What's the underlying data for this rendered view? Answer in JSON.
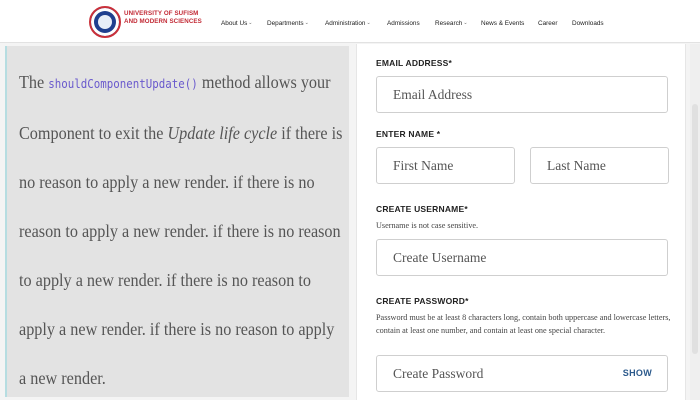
{
  "header": {
    "university_line1": "UNIVERSITY OF SUFISM",
    "university_line2": "AND MODERN SCIENCES",
    "nav": [
      {
        "label": "About Us",
        "dropdown": true
      },
      {
        "label": "Departments",
        "dropdown": true
      },
      {
        "label": "Administration",
        "dropdown": true
      },
      {
        "label": "Admissions",
        "dropdown": false
      },
      {
        "label": "Research",
        "dropdown": true
      },
      {
        "label": "News & Events",
        "dropdown": false
      },
      {
        "label": "Career",
        "dropdown": false
      },
      {
        "label": "Downloads",
        "dropdown": false
      }
    ]
  },
  "article": {
    "the": "The",
    "code": "shouldComponentUpdate()",
    "after_code": " method allows your Component to exit the ",
    "lifecycle": "Update life cycle",
    "body": " if there is no reason to apply a new render. if there is no reason to apply a new render. if there is no reason to apply a new render. if there is no reason to apply a new render. if there is no reason to apply a new render."
  },
  "form": {
    "email_label": "EMAIL ADDRESS*",
    "email_placeholder": "Email Address",
    "name_label": "ENTER NAME *",
    "first_name_placeholder": "First Name",
    "last_name_placeholder": "Last Name",
    "username_label": "CREATE USERNAME*",
    "username_hint": "Username is not case sensitive.",
    "username_placeholder": "Create Username",
    "password_label": "CREATE PASSWORD*",
    "password_hint": "Password must be at least 8 characters long, contain both uppercase and lowercase letters, contain at least one number, and contain at least one special character.",
    "password_placeholder": "Create Password",
    "show_label": "SHOW"
  },
  "colors": {
    "brand_red": "#c22a35",
    "brand_blue": "#1f3f8f",
    "code_purple": "#6a5acd",
    "show_blue": "#2c5a8c"
  }
}
